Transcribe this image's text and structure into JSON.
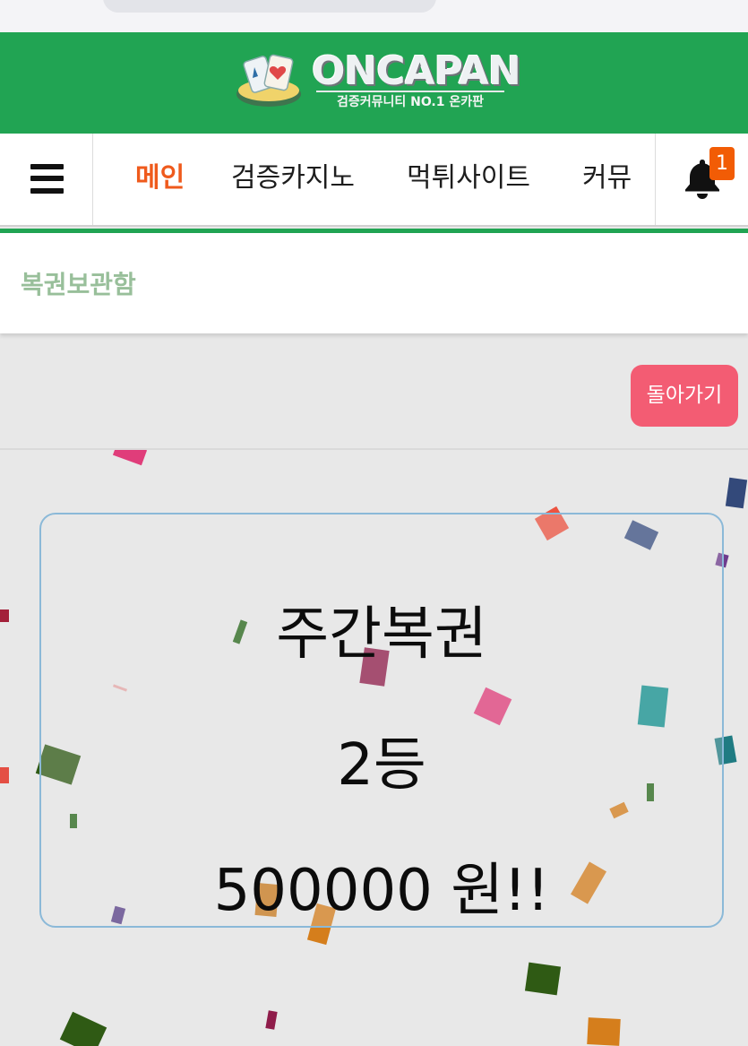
{
  "header": {
    "logo_text": "ONCAPAN",
    "tagline": "검증커뮤니티 NO.1 온카판"
  },
  "nav": {
    "items": [
      {
        "label": "메인",
        "active": true
      },
      {
        "label": "검증카지노",
        "active": false
      },
      {
        "label": "먹튀사이트",
        "active": false
      },
      {
        "label": "커뮤",
        "active": false
      }
    ],
    "notification_count": "1"
  },
  "page": {
    "title": "복권보관함",
    "back_label": "돌아가기"
  },
  "result": {
    "lottery_name": "주간복권",
    "rank": "2등",
    "prize": "500000 원!!"
  },
  "colors": {
    "brand_green": "#21a453",
    "active_nav": "#ef5a1c",
    "back_button": "#f35c73",
    "badge": "#f25c05"
  }
}
